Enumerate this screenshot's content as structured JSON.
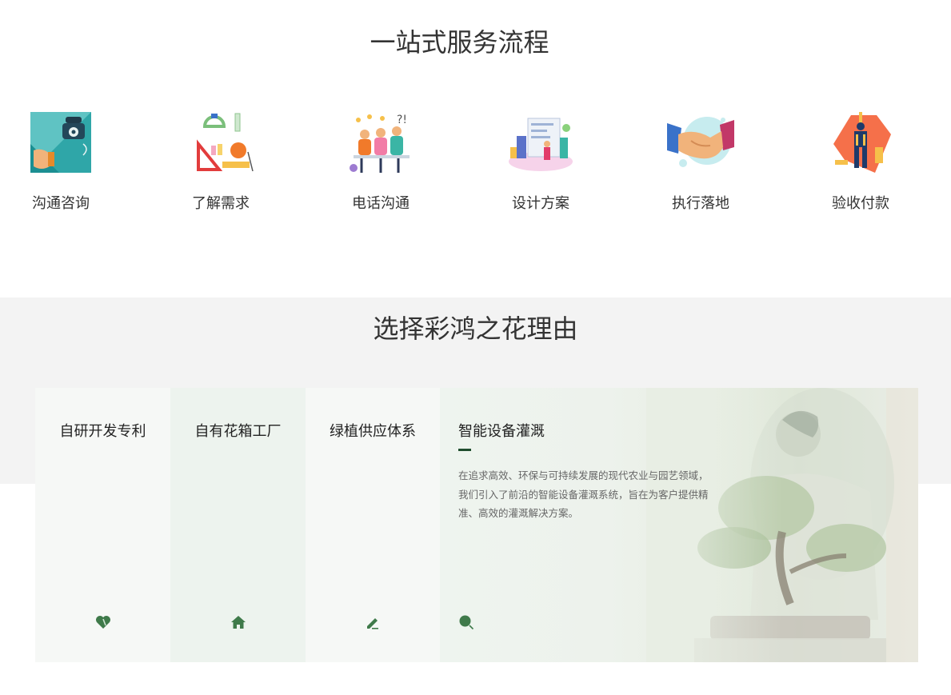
{
  "process": {
    "title": "一站式服务流程",
    "steps": [
      {
        "label": "沟通咨询",
        "icon": "telephone-consult-icon"
      },
      {
        "label": "了解需求",
        "icon": "drafting-tools-icon"
      },
      {
        "label": "电话沟通",
        "icon": "team-discussion-icon"
      },
      {
        "label": "设计方案",
        "icon": "design-plan-icon"
      },
      {
        "label": "执行落地",
        "icon": "handshake-icon"
      },
      {
        "label": "验收付款",
        "icon": "construction-worker-icon"
      }
    ]
  },
  "reasons": {
    "title": "选择彩鸿之花理由",
    "panels": [
      {
        "title": "自研开发专利",
        "icon": "heart-leaf-icon"
      },
      {
        "title": "自有花箱工厂",
        "icon": "home-icon"
      },
      {
        "title": "绿植供应体系",
        "icon": "pencil-icon"
      },
      {
        "title": "智能设备灌溉",
        "icon": "search-icon",
        "description_lines": [
          "在追求高效、环保与可持续发展的现代农业与园艺领域，",
          "我们引入了前沿的智能设备灌溉系统，旨在为客户提供精",
          "准、高效的灌溉解决方案。"
        ]
      }
    ]
  },
  "colors": {
    "icon_green": "#3f7a4a",
    "accent_dark_green": "#1f4d2e",
    "band_gray": "#f3f3f3"
  }
}
